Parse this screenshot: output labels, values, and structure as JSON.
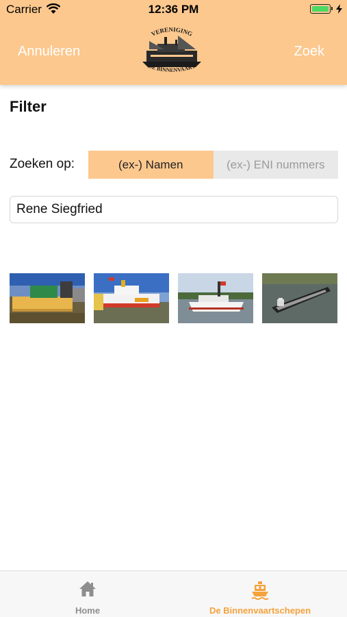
{
  "status_bar": {
    "carrier": "Carrier",
    "time": "12:36 PM"
  },
  "nav": {
    "cancel_label": "Annuleren",
    "search_label": "Zoek",
    "logo_text_top": "VERENIGING",
    "logo_text_bottom": "'DE BINNENVAART'"
  },
  "filter": {
    "title": "Filter",
    "search_on_label": "Zoeken op:",
    "segments": [
      "(ex-) Namen",
      "(ex-) ENI nummers"
    ],
    "selected_segment": "(ex-) Namen",
    "input_value": "Rene Siegfried"
  },
  "tabbar": {
    "items": [
      {
        "label": "Home",
        "icon": "home-icon"
      },
      {
        "label": "De Binnenvaartschepen",
        "icon": "ship-icon"
      }
    ]
  },
  "colors": {
    "accent": "#fcc88e",
    "tab_active": "#f5a23c",
    "tab_inactive": "#8e8e8e"
  }
}
